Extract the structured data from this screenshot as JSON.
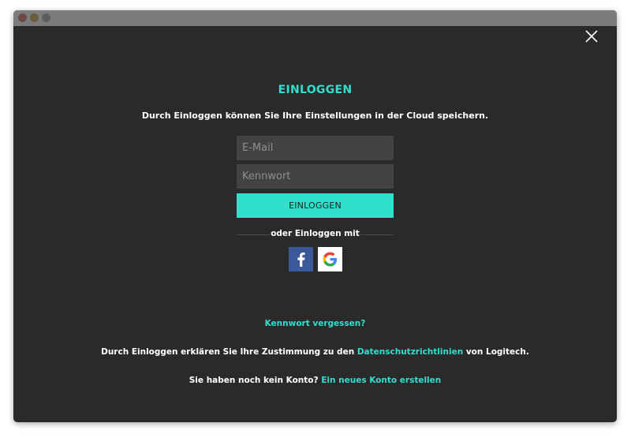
{
  "window": {
    "icons": {
      "close": "close-icon"
    }
  },
  "login": {
    "title": "EINLOGGEN",
    "subtitle": "Durch Einloggen können Sie Ihre Einstellungen in der Cloud speichern.",
    "email_placeholder": "E-Mail",
    "email_value": "",
    "password_placeholder": "Kennwort",
    "password_value": "",
    "submit_label": "EINLOGGEN",
    "divider_text": "oder Einloggen mit",
    "social": [
      {
        "name": "facebook",
        "icon": "facebook-icon",
        "color": "#3b5998"
      },
      {
        "name": "google",
        "icon": "google-icon",
        "color": "#ffffff"
      }
    ],
    "forgot_password": "Kennwort vergessen?",
    "consent_prefix": "Durch Einloggen erklären Sie Ihre Zustimmung zu den",
    "consent_link": "Datenschutzrichtlinien",
    "consent_suffix": "von Logitech.",
    "no_account_text": "Sie haben noch kein Konto?",
    "create_account_link": "Ein neues Konto erstellen"
  },
  "colors": {
    "accent": "#2fe0cc",
    "background": "#2a2a2b",
    "field_background": "#414243",
    "text": "#ffffff"
  }
}
